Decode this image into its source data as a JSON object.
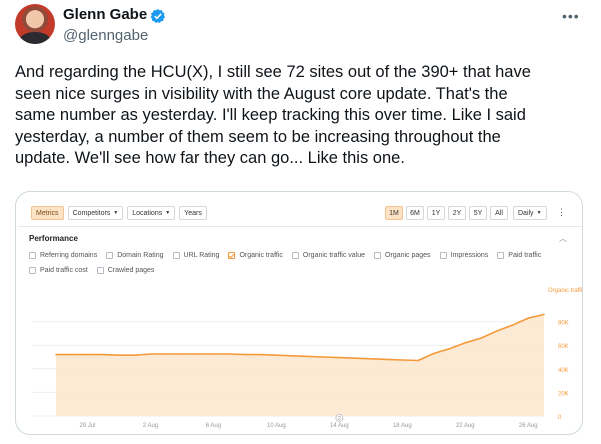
{
  "tweet": {
    "author_name": "Glenn Gabe",
    "handle": "@glenngabe",
    "text_lines": [
      "And regarding the HCU(X), I still see 72 sites out of the 390+ that have",
      "seen nice surges in visibility with the August core update. That's the",
      "same number as yesterday. I'll keep tracking this over time. Like I said",
      "yesterday, a number of them seem to be increasing throughout the",
      "update. We'll see how far they can go... Like this one."
    ]
  },
  "screenshot": {
    "toolbar": {
      "tabs": [
        "Metrics",
        "Competitors",
        "Locations",
        "Years"
      ],
      "ranges": [
        "1M",
        "6M",
        "1Y",
        "2Y",
        "5Y",
        "All"
      ],
      "active_range": "1M",
      "interval": "Daily"
    },
    "performance": {
      "title": "Performance",
      "metrics": [
        {
          "label": "Referring domains",
          "checked": false
        },
        {
          "label": "Domain Rating",
          "checked": false
        },
        {
          "label": "URL Rating",
          "checked": false
        },
        {
          "label": "Organic traffic",
          "checked": true
        },
        {
          "label": "Organic traffic value",
          "checked": false
        },
        {
          "label": "Organic pages",
          "checked": false
        },
        {
          "label": "Impressions",
          "checked": false
        },
        {
          "label": "Paid traffic",
          "checked": false
        },
        {
          "label": "Paid traffic cost",
          "checked": false
        },
        {
          "label": "Crawled pages",
          "checked": false
        }
      ]
    },
    "colors": {
      "accent": "#f49a3c",
      "fill": "#fde6cd",
      "verified": "#1d9bf0"
    }
  },
  "chart_data": {
    "type": "area",
    "series": [
      {
        "name": "Organic traffic",
        "values": [
          52000,
          52000,
          52000,
          52000,
          51500,
          51500,
          52500,
          52500,
          52500,
          52500,
          52500,
          52500,
          52000,
          52000,
          51500,
          51000,
          50500,
          50000,
          49500,
          49000,
          48500,
          48000,
          47500,
          47000,
          53000,
          57000,
          62000,
          66000,
          72000,
          77000,
          83000,
          86000
        ]
      }
    ],
    "x": [
      "27 Jul",
      "28 Jul",
      "29 Jul",
      "30 Jul",
      "31 Jul",
      "1 Aug",
      "2 Aug",
      "3 Aug",
      "4 Aug",
      "5 Aug",
      "6 Aug",
      "7 Aug",
      "8 Aug",
      "9 Aug",
      "10 Aug",
      "11 Aug",
      "12 Aug",
      "13 Aug",
      "14 Aug",
      "15 Aug",
      "16 Aug",
      "17 Aug",
      "18 Aug",
      "19 Aug",
      "20 Aug",
      "21 Aug",
      "22 Aug",
      "23 Aug",
      "24 Aug",
      "25 Aug",
      "26 Aug",
      "27 Aug"
    ],
    "x_tick_labels": [
      "29 Jul",
      "2 Aug",
      "6 Aug",
      "10 Aug",
      "14 Aug",
      "18 Aug",
      "22 Aug",
      "26 Aug"
    ],
    "y_tick_labels": [
      "80K",
      "60K",
      "40K",
      "20K",
      "0"
    ],
    "ylim": [
      0,
      100000
    ],
    "annotation_marker": "2",
    "grid": true
  }
}
